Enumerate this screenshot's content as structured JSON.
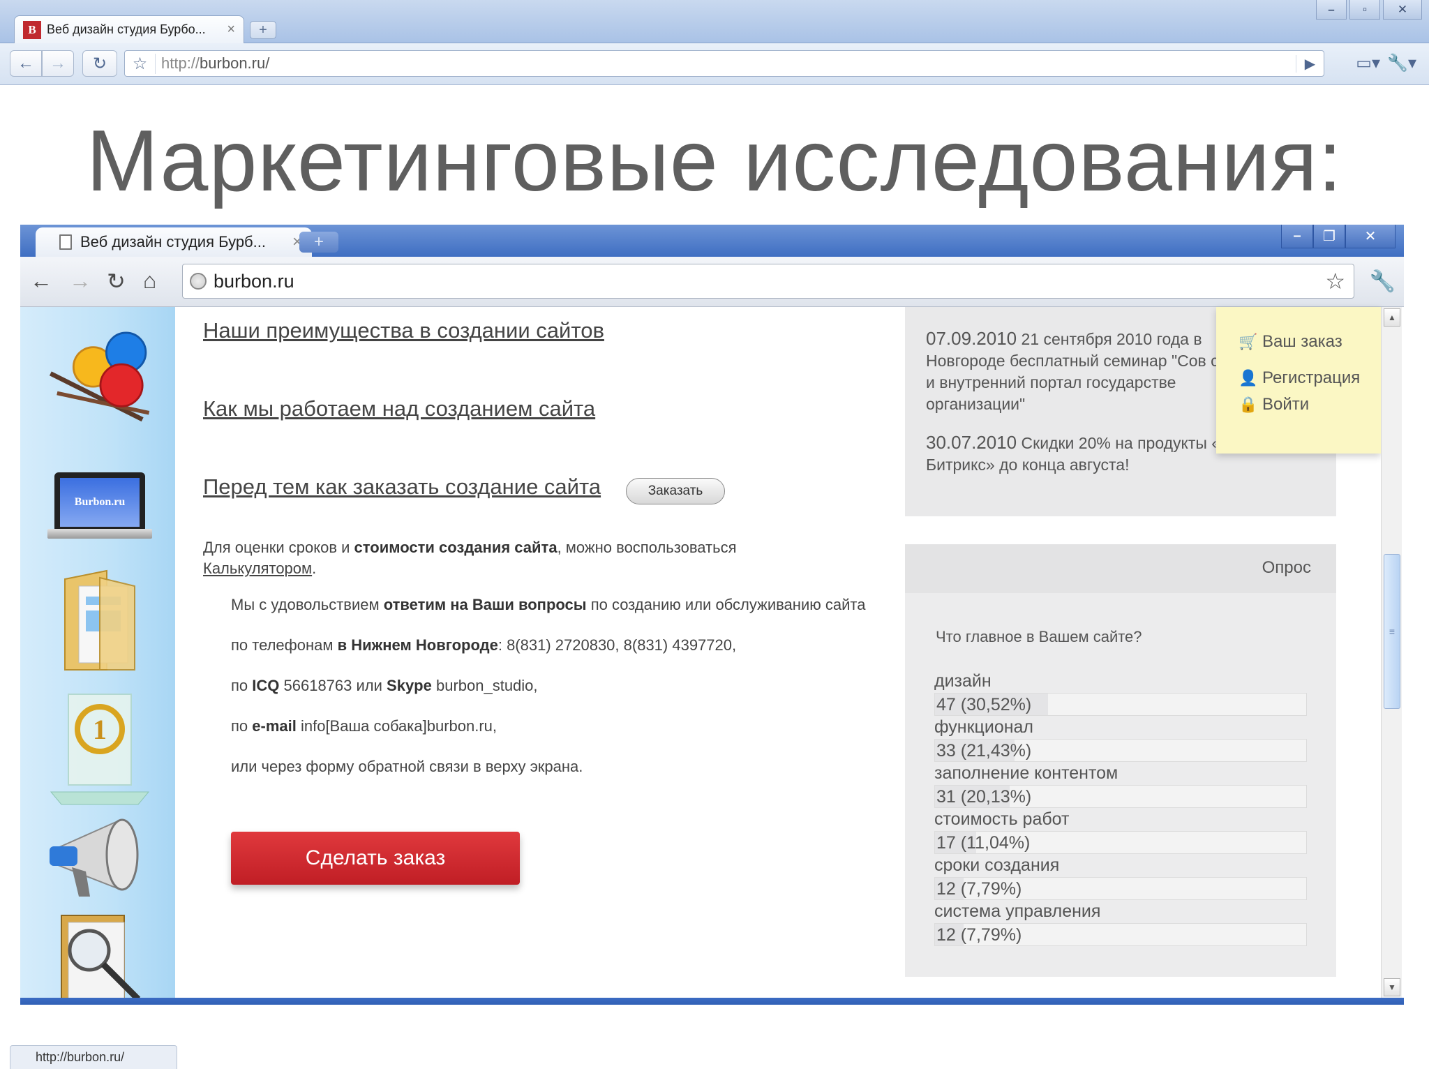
{
  "outer_browser": {
    "tab_title": "Веб дизайн студия Бурбо...",
    "favicon_letter": "B",
    "url_proto": "http://",
    "url_host": "burbon.ru/",
    "status_url": "http://burbon.ru/"
  },
  "slide": {
    "title": "Маркетинговые исследования:"
  },
  "inner_browser": {
    "tab_title": "Веб дизайн студия Бурб...",
    "url": "burbon.ru"
  },
  "site": {
    "laptop_label": "Burbon.ru",
    "links": [
      "Наши преимущества в создании сайтов",
      "Как мы работаем над созданием сайта",
      "Перед тем как заказать создание сайта"
    ],
    "order_small_label": "Заказать",
    "calc": {
      "part1": "Для оценки сроков и ",
      "bold": "стоимости создания сайта",
      "part2": ", можно воспользоваться",
      "link": "Калькулятором",
      "end": "."
    },
    "contacts": {
      "line1_a": "Мы с удовольствием ",
      "line1_b": "ответим на Ваши вопросы",
      "line1_c": " по созданию или обслуживанию сайта",
      "line2_a": "по телефонам ",
      "line2_b": "в Нижнем Новгороде",
      "line2_c": ": 8(831) 2720830, 8(831) 4397720,",
      "line3_a": "по ",
      "line3_b": "ICQ",
      "line3_c": " 56618763 или ",
      "line3_d": "Skype",
      "line3_e": " burbon_studio,",
      "line4_a": "по ",
      "line4_b": "e-mail",
      "line4_c": " info[Ваша собака]burbon.ru,",
      "line5": "или через форму обратной связи в верху экрана."
    },
    "big_order_label": "Сделать заказ",
    "news": [
      {
        "date": "07.09.2010",
        "text": " 21 сентября 2010 года в Новгороде бесплатный семинар \"Сов сайт и внутренний портал государстве организации\""
      },
      {
        "date": "30.07.2010",
        "text": " Скидки 20% на продукты «1С-Битрикс» до конца августа!"
      }
    ],
    "cart": {
      "order": "Ваш заказ",
      "register": "Регистрация",
      "login": "Войти"
    },
    "poll": {
      "heading": "Опрос",
      "question": "Что главное в Вашем сайте?",
      "options": [
        {
          "label": "дизайн",
          "result": "47 (30,52%)",
          "percent": 30.52
        },
        {
          "label": "функционал",
          "result": "33 (21,43%)",
          "percent": 21.43
        },
        {
          "label": "заполнение контентом",
          "result": "31 (20,13%)",
          "percent": 20.13
        },
        {
          "label": "стоимость работ",
          "result": "17 (11,04%)",
          "percent": 11.04
        },
        {
          "label": "сроки создания",
          "result": "12 (7,79%)",
          "percent": 7.79
        },
        {
          "label": "система управления",
          "result": "12 (7,79%)",
          "percent": 7.79
        }
      ]
    }
  }
}
